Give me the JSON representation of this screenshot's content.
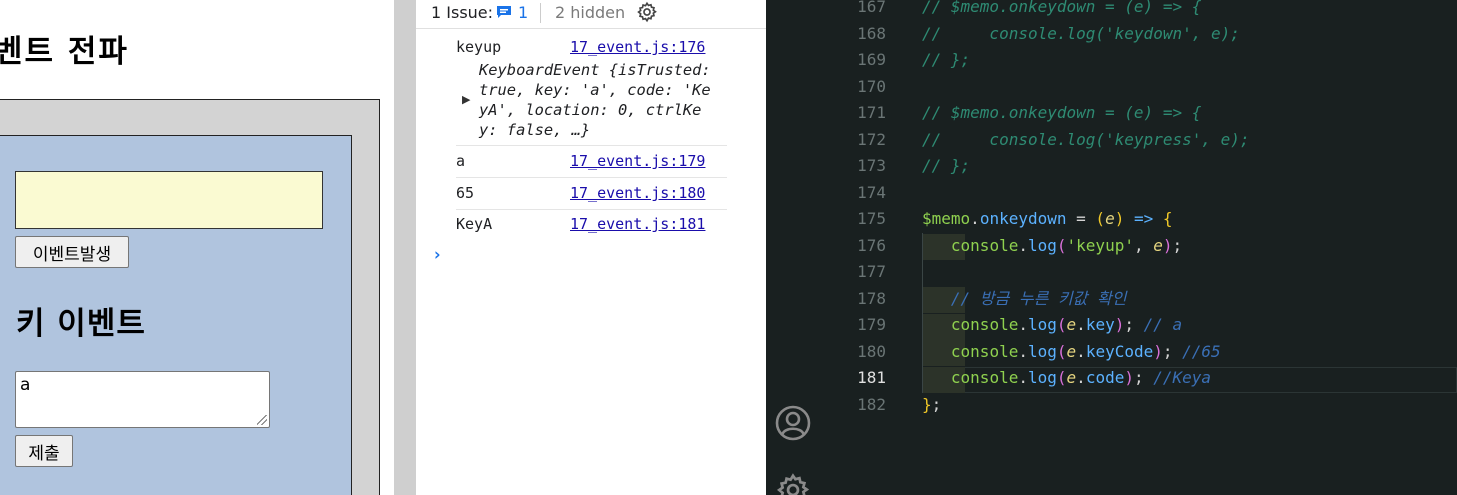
{
  "browser_page": {
    "heading_propagation": "벤트 전파",
    "event_button_label": "이벤트발생",
    "heading_key_event": "키 이벤트",
    "memo_value": "a",
    "submit_button_label": "제출",
    "colors": {
      "outer_box": "#d3d3d3",
      "inner_box": "#b0c4de",
      "input_bg": "#fafad2"
    }
  },
  "devtools": {
    "toolbar": {
      "issues_label": "1 Issue:",
      "issues_count": "1",
      "hidden_label": "2 hidden"
    },
    "console": [
      {
        "message": "keyup",
        "source": "17_event.js:176"
      },
      {
        "message": "a",
        "source": "17_event.js:179"
      },
      {
        "message": "65",
        "source": "17_event.js:180"
      },
      {
        "message": "KeyA",
        "source": "17_event.js:181"
      }
    ],
    "object_preview": {
      "type": "KeyboardEvent",
      "line1": "KeyboardEvent {isTrusted:",
      "line2": "true, key: 'a', code: 'Ke",
      "line3": "yA', location: 0, ctrlKe",
      "line4": "y: false, …}"
    },
    "prompt": "›"
  },
  "editor": {
    "line_numbers": [
      "167",
      "168",
      "169",
      "170",
      "171",
      "172",
      "173",
      "174",
      "175",
      "176",
      "177",
      "178",
      "179",
      "180",
      "181",
      "182"
    ],
    "active_line": "181",
    "lines": {
      "l167": "// $memo.onkeydown = (e) => {",
      "l168": "//     console.log('keydown', e);",
      "l169": "// };",
      "l171": "// $memo.onkeydown = (e) => {",
      "l172": "//     console.log('keypress', e);",
      "l173": "// };",
      "l178_comment": "// 방금 누른 키값 확인",
      "l179_comment": "// a",
      "l180_comment": "//65",
      "l181_comment": "//Keya"
    },
    "tokens": {
      "memo": "$memo",
      "onkeydown": "onkeydown",
      "e": "e",
      "console": "console",
      "log": "log",
      "keyup_str": "'keyup'",
      "key": "key",
      "keyCode": "keyCode",
      "code": "code"
    },
    "colors": {
      "background": "#192020",
      "comment": "#2e8b73"
    }
  }
}
